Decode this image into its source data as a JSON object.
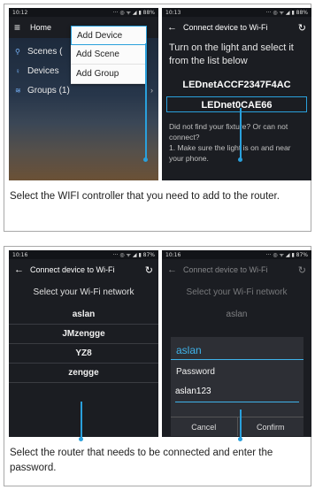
{
  "panel1": {
    "screen1": {
      "status_time": "10:12",
      "status_right": "··· ◎ ᯤ ◢ ▮ 88%",
      "title": "Home",
      "list": [
        {
          "icon": "lightbulb-icon",
          "label": "Scenes ("
        },
        {
          "icon": "lightbulb-icon",
          "label": "Devices"
        },
        {
          "icon": "wifi-icon",
          "label": "Groups (1)"
        }
      ],
      "menu": [
        "Add Device",
        "Add Scene",
        "Add Group"
      ]
    },
    "screen2": {
      "status_time": "10:13",
      "status_right": "··· ◎ ᯤ ◢ ▮ 88%",
      "title": "Connect device to Wi-Fi",
      "instructions": "Turn on the light and select it from the list below",
      "devices": [
        "LEDnetACCF2347F4AC",
        "LEDnet0CAE66"
      ],
      "help": "Did not find your fixture? Or can not connect?\n1. Make sure the light is on and near your phone."
    },
    "caption": "Select the WIFI controller that you need to add to the router."
  },
  "panel2": {
    "screen3": {
      "status_time": "10:16",
      "status_right": "··· ◎ ᯤ ◢ ▮ 87%",
      "title": "Connect device to Wi-Fi",
      "heading": "Select your Wi-Fi network",
      "networks": [
        "aslan",
        "JMzengge",
        "YZ8",
        "zengge"
      ]
    },
    "screen4": {
      "status_time": "10:16",
      "status_right": "··· ◎ ᯤ ◢ ▮ 87%",
      "title": "Connect device to Wi-Fi",
      "heading": "Select your Wi-Fi network",
      "networks": [
        "aslan"
      ],
      "dialog": {
        "ssid": "aslan",
        "password_label": "Password",
        "password_value": "aslan123",
        "cancel": "Cancel",
        "confirm": "Confirm"
      }
    },
    "caption": "Select the router that needs to be connected and enter the password."
  },
  "colors": {
    "accent": "#2aa0dc",
    "dialog_accent": "#3fb3ea",
    "phone_bg": "#1b1d22"
  }
}
